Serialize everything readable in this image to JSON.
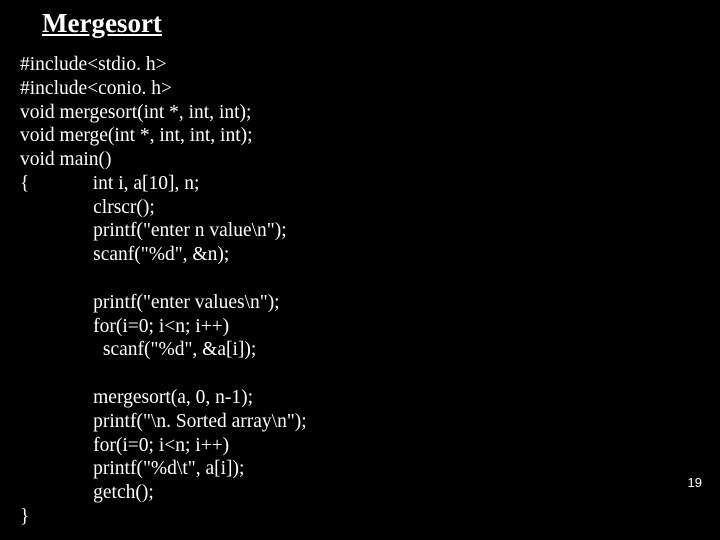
{
  "slide": {
    "title": "Mergesort",
    "page_number": "19",
    "code_lines": {
      "l01": "#include<stdio. h>",
      "l02": "#include<conio. h>",
      "l03": "void mergesort(int *, int, int);",
      "l04": "void merge(int *, int, int, int);",
      "l05": "void main()",
      "l06": "{             int i, a[10], n;",
      "l07": "               clrscr();",
      "l08": "               printf(\"enter n value\\n\");",
      "l09": "               scanf(\"%d\", &n);",
      "l10": "",
      "l11": "               printf(\"enter values\\n\");",
      "l12": "               for(i=0; i<n; i++)",
      "l13": "                 scanf(\"%d\", &a[i]);",
      "l14": "",
      "l15": "               mergesort(a, 0, n-1);",
      "l16": "               printf(\"\\n. Sorted array\\n\");",
      "l17": "               for(i=0; i<n; i++)",
      "l18": "               printf(\"%d\\t\", a[i]);",
      "l19": "               getch();",
      "l20": "}"
    }
  }
}
